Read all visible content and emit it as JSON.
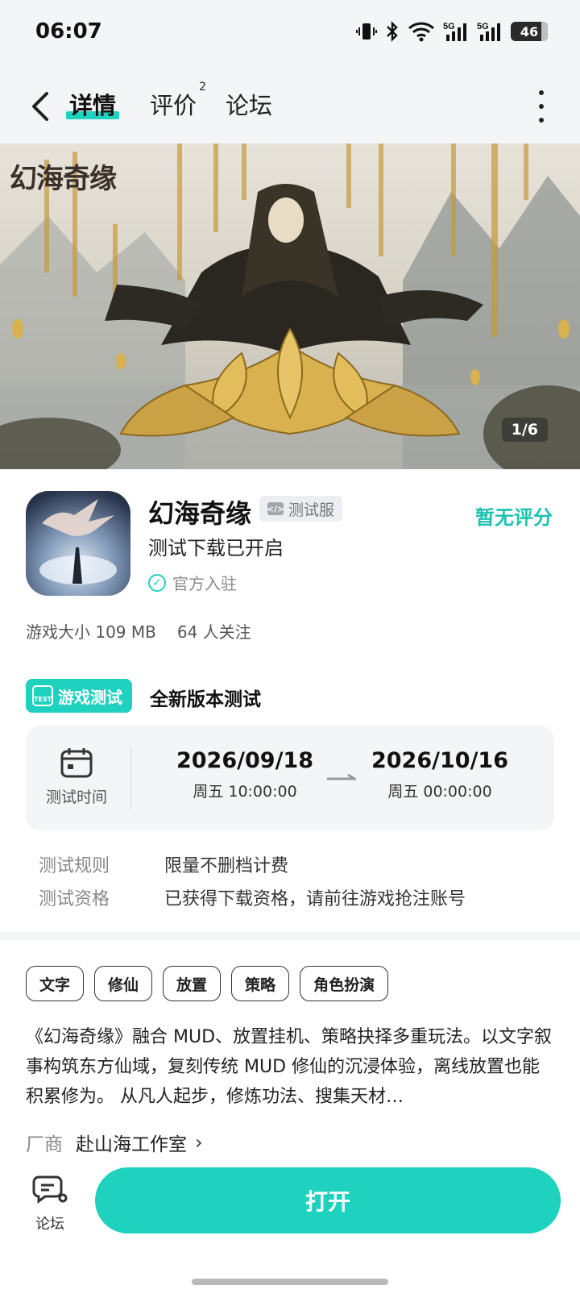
{
  "status_bar": {
    "time": "06:07",
    "battery": "46",
    "network_1": "5G",
    "network_2": "5G"
  },
  "header": {
    "tabs": [
      {
        "label": "详情"
      },
      {
        "label": "评价",
        "badge": "2"
      },
      {
        "label": "论坛"
      }
    ]
  },
  "banner": {
    "logo_text": "幻海奇缘",
    "counter": "1/6"
  },
  "app": {
    "name": "幻海奇缘",
    "badge": "测试服",
    "rating": "暂无评分",
    "subtitle": "测试下载已开启",
    "official": "官方入驻",
    "size": "游戏大小 109 MB",
    "followers": "64 人关注"
  },
  "test": {
    "tag": "游戏测试",
    "tag_icon_text": "TEST",
    "title": "全新版本测试",
    "time_label": "测试时间",
    "start_date": "2026/09/18",
    "start_time": "周五  10:00:00",
    "end_date": "2026/10/16",
    "end_time": "周五  00:00:00",
    "rules": [
      {
        "key": "测试规则",
        "value": "限量不删档计费"
      },
      {
        "key": "测试资格",
        "value": "已获得下载资格，请前往游戏抢注账号"
      }
    ]
  },
  "tags": [
    "文字",
    "修仙",
    "放置",
    "策略",
    "角色扮演"
  ],
  "description": "《幻海奇缘》融合 MUD、放置挂机、策略抉择多重玩法。以文字叙事构筑东方仙域，复刻传统 MUD 修仙的沉浸体验，离线放置也能积累修为。 从凡人起步，修炼功法、搜集天材…",
  "vendor": {
    "key": "厂商",
    "value": "赴山海工作室"
  },
  "bottom": {
    "forum_label": "论坛",
    "open_label": "打开"
  },
  "colors": {
    "accent": "#1fd1bf",
    "background": "#f4f5f7"
  }
}
